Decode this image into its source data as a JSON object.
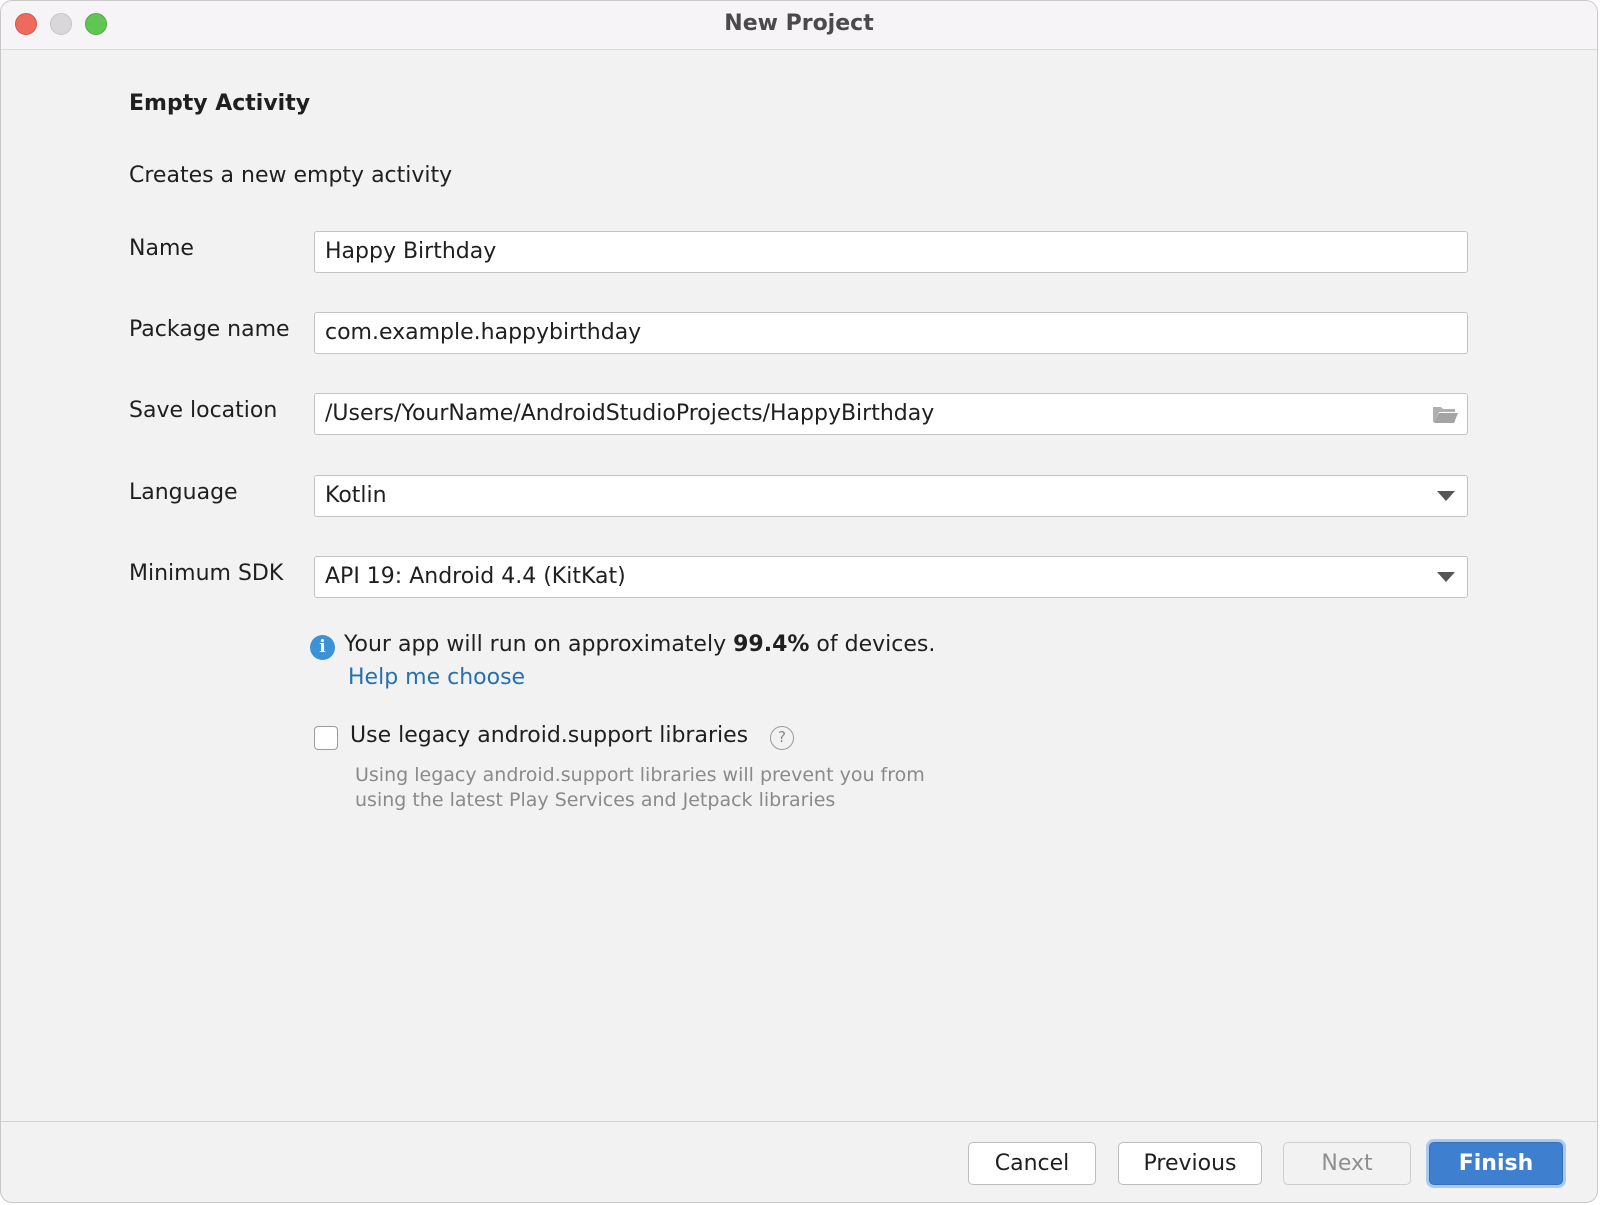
{
  "window": {
    "title": "New Project"
  },
  "form": {
    "heading": "Empty Activity",
    "description": "Creates a new empty activity",
    "name": {
      "label": "Name",
      "value": "Happy Birthday"
    },
    "package_name": {
      "label": "Package name",
      "value": "com.example.happybirthday"
    },
    "save_location": {
      "label": "Save location",
      "value": "/Users/YourName/AndroidStudioProjects/HappyBirthday",
      "icon": "folder-icon"
    },
    "language": {
      "label": "Language",
      "value": "Kotlin"
    },
    "minimum_sdk": {
      "label": "Minimum SDK",
      "value": "API 19: Android 4.4 (KitKat)"
    },
    "info": {
      "icon": "info-icon",
      "prefix": "Your app will run on approximately ",
      "percent": "99.4%",
      "suffix": " of devices.",
      "help_link": "Help me choose"
    },
    "legacy_support": {
      "checked": false,
      "label": "Use legacy android.support libraries",
      "help_icon_glyph": "?",
      "hint": "Using legacy android.support libraries will prevent you from using the latest Play Services and Jetpack libraries"
    }
  },
  "footer": {
    "cancel": "Cancel",
    "previous": "Previous",
    "next": "Next",
    "finish": "Finish"
  },
  "colors": {
    "accent": "#3f7fd0",
    "link": "#2470b3",
    "info": "#3d92d6"
  }
}
